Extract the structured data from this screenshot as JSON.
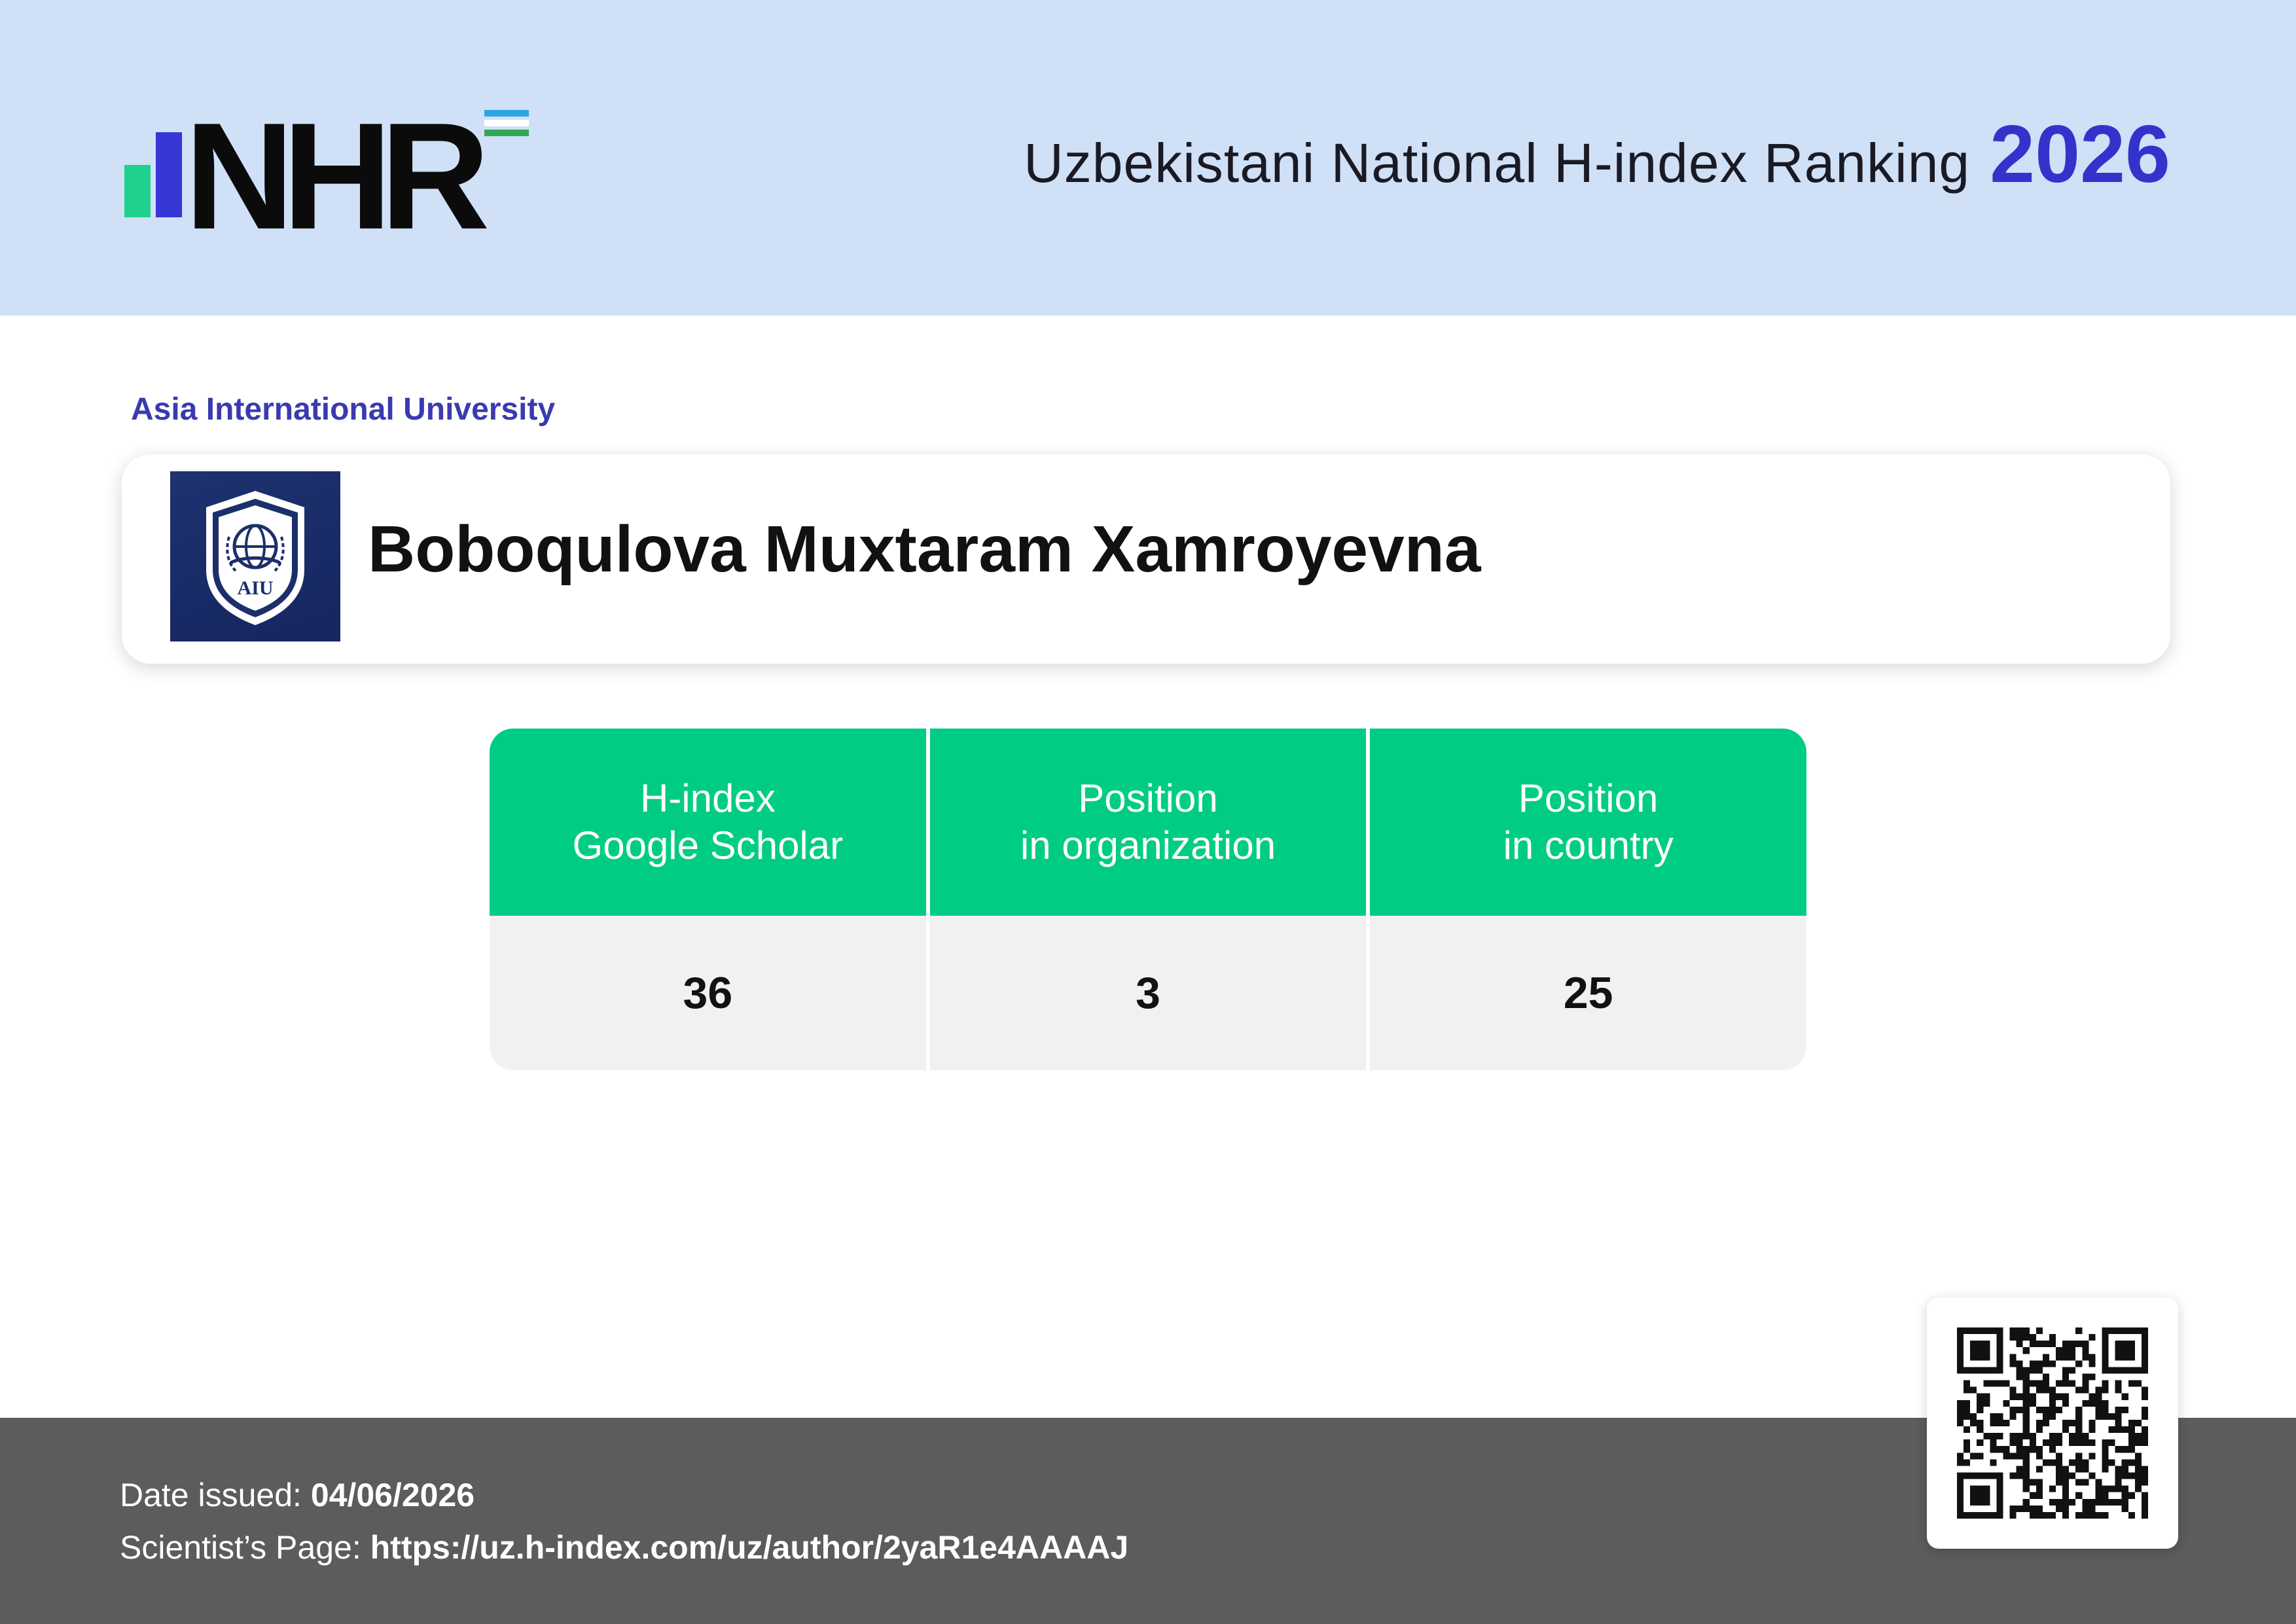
{
  "header": {
    "logo_text": "NHR",
    "title": "Uzbekistani National H-index Ranking",
    "year": "2026"
  },
  "organization": {
    "name": "Asia International University",
    "logo_text": "AIU"
  },
  "scientist": {
    "name": "Boboqulova Muxtaram Xamroyevna"
  },
  "stats": {
    "columns": [
      {
        "line1": "H-index",
        "line2": "Google Scholar",
        "value": "36"
      },
      {
        "line1": "Position",
        "line2": "in organization",
        "value": "3"
      },
      {
        "line1": "Position",
        "line2": "in country",
        "value": "25"
      }
    ]
  },
  "footer": {
    "date_label": "Date issued:",
    "date_value": "04/06/2026",
    "page_label": "Scientist’s Page:",
    "page_url": "https://uz.h-index.com/uz/author/2yaR1e4AAAAJ"
  },
  "colors": {
    "header_bg": "#cfe0f7",
    "accent_blue": "#3333cc",
    "table_green": "#00cc84",
    "footer_bg": "#5c5c5c"
  },
  "icons": {
    "qr": "qr-code-icon",
    "org_logo": "university-crest-icon"
  }
}
